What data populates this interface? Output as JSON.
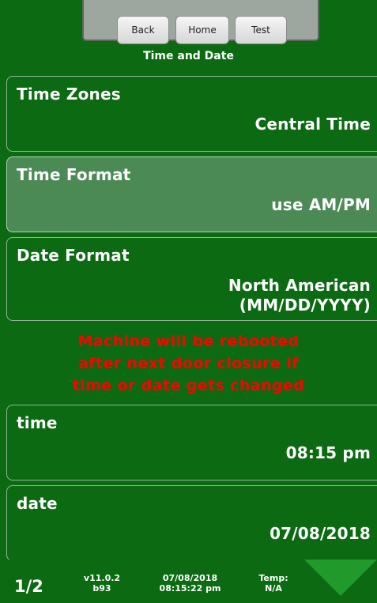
{
  "top_bar": {
    "back_label": "Back",
    "home_label": "Home",
    "test_label": "Test"
  },
  "screen_title": "Time and Date",
  "settings": [
    {
      "name": "Time Zones",
      "value": "Central Time"
    },
    {
      "name": "Time Format",
      "value": "use AM/PM"
    },
    {
      "name": "Date Format",
      "value": "North American",
      "value_line2": "(MM/DD/YYYY)"
    }
  ],
  "warning": {
    "line1": "Machine will be rebooted",
    "line2": "after next door closure if",
    "line3": "time or date gets changed"
  },
  "time": {
    "label": "time",
    "value": "08:15 pm"
  },
  "date": {
    "label": "date",
    "value": "07/08/2018"
  },
  "footer": {
    "page": "1/2",
    "version": "v11.0.2",
    "build": "b93",
    "current_date": "07/08/2018",
    "current_time": "08:15:22 pm",
    "temp_label": "Temp:",
    "temp_value": "N/A"
  },
  "colors": {
    "background": "#0b6a12",
    "selected_row": "#4c8a55",
    "warning": "#ff0000",
    "arrow": "#1f9a2b"
  },
  "icons": {
    "next_page": "down-arrow-icon"
  }
}
